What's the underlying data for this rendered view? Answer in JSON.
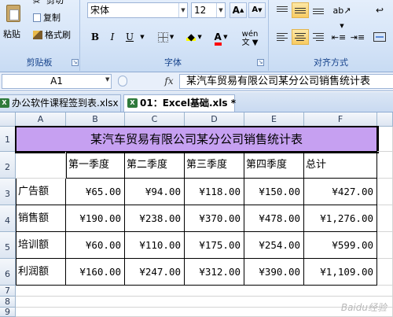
{
  "ribbon": {
    "clipboard": {
      "cut": "剪切",
      "copy": "复制",
      "format_painter": "格式刷",
      "paste": "粘贴",
      "title": "剪贴板"
    },
    "font": {
      "name": "宋体",
      "size": "12",
      "grow": "A",
      "shrink": "A",
      "bold": "B",
      "italic": "I",
      "underline": "U",
      "fill_letter": "A",
      "phonetic": "wén",
      "title": "字体"
    },
    "alignment": {
      "title": "对齐方式"
    }
  },
  "formula_bar": {
    "name_box": "A1",
    "fx": "fx",
    "content": "某汽车贸易有限公司某分公司销售统计表"
  },
  "workbook_tabs": [
    {
      "label": "办公软件课程签到表.xlsx"
    },
    {
      "label": "01：Excel基础.xls *"
    }
  ],
  "sheet": {
    "columns": [
      "A",
      "B",
      "C",
      "D",
      "E",
      "F"
    ],
    "rows": [
      "1",
      "2",
      "3",
      "4",
      "5",
      "6",
      "7",
      "8",
      "9"
    ],
    "title": "某汽车贸易有限公司某分公司销售统计表",
    "header": [
      "第一季度",
      "第二季度",
      "第三季度",
      "第四季度",
      "总计"
    ],
    "data": [
      {
        "label": "广告额",
        "values": [
          "¥65.00",
          "¥94.00",
          "¥118.00",
          "¥150.00",
          "¥427.00"
        ]
      },
      {
        "label": "销售额",
        "values": [
          "¥190.00",
          "¥238.00",
          "¥370.00",
          "¥478.00",
          "¥1,276.00"
        ]
      },
      {
        "label": "培训额",
        "values": [
          "¥60.00",
          "¥110.00",
          "¥175.00",
          "¥254.00",
          "¥599.00"
        ]
      },
      {
        "label": "利润额",
        "values": [
          "¥160.00",
          "¥247.00",
          "¥312.00",
          "¥390.00",
          "¥1,109.00"
        ]
      }
    ]
  },
  "watermark": "Baidu经验",
  "colors": {
    "title_fill": "#c6a0f1",
    "ribbon": "#d6e5f8",
    "font_color_bar": "#ff0000"
  }
}
